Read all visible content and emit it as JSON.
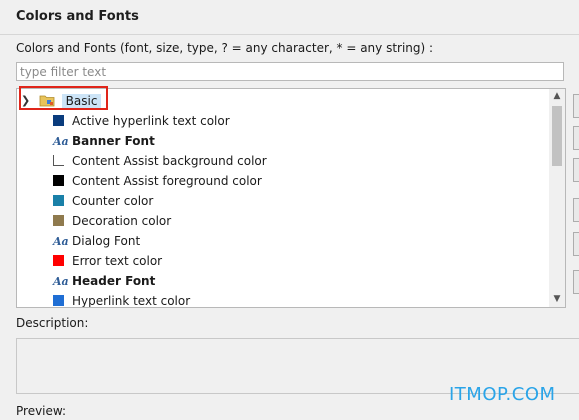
{
  "header": {
    "title": "Colors and Fonts"
  },
  "filter": {
    "label": "Colors and Fonts (font, size, type, ? = any character, * = any string) :",
    "placeholder": "type filter text"
  },
  "tree": {
    "root": {
      "label": "Basic",
      "icon": "folder-icon",
      "expanded": true
    },
    "items": [
      {
        "label": "Active hyperlink text color",
        "kind": "color",
        "color": "#0a3c7d",
        "bold": false
      },
      {
        "label": "Banner Font",
        "kind": "font",
        "bold": true
      },
      {
        "label": "Content Assist background color",
        "kind": "color",
        "color": "#ffffff",
        "bold": false
      },
      {
        "label": "Content Assist foreground color",
        "kind": "color",
        "color": "#000000",
        "bold": false
      },
      {
        "label": "Counter color",
        "kind": "color",
        "color": "#1a80a8",
        "bold": false
      },
      {
        "label": "Decoration color",
        "kind": "color",
        "color": "#8f7a4e",
        "bold": false
      },
      {
        "label": "Dialog Font",
        "kind": "font",
        "bold": false
      },
      {
        "label": "Error text color",
        "kind": "color",
        "color": "#ff0000",
        "bold": false
      },
      {
        "label": "Header Font",
        "kind": "font",
        "bold": true
      },
      {
        "label": "Hyperlink text color",
        "kind": "color",
        "color": "#1f6ed4",
        "bold": false
      }
    ]
  },
  "description": {
    "label": "Description:"
  },
  "preview": {
    "label": "Preview:"
  },
  "watermark": "ITMOP.COM"
}
